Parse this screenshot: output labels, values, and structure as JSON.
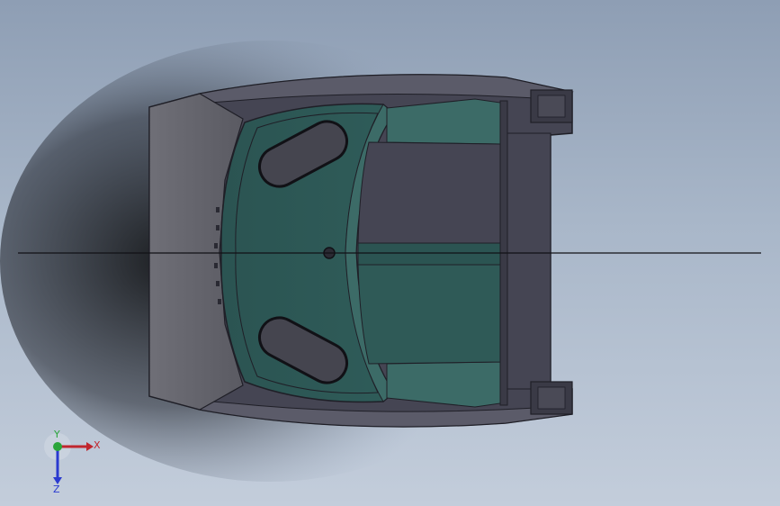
{
  "app": {
    "view_type": "3d-cad-viewport",
    "background_top": "#8e9eb4",
    "background_bottom": "#c3cddb"
  },
  "model": {
    "shell_color": "#454553",
    "shell_top_color": "#5b5b69",
    "face_color": "#6a6a72",
    "deck_color": "#2f5a57",
    "deck_edge_color": "#3c6b67",
    "edge_color": "#1f1f27",
    "pontoon_color": "#3a3a46"
  },
  "triad": {
    "x_label": "X",
    "y_label": "Y",
    "z_label": "Z",
    "x_color": "#c0262e",
    "y_color": "#2aa53a",
    "z_color": "#2a3ad0"
  },
  "icons": {
    "triad": "axis-triad-icon"
  }
}
